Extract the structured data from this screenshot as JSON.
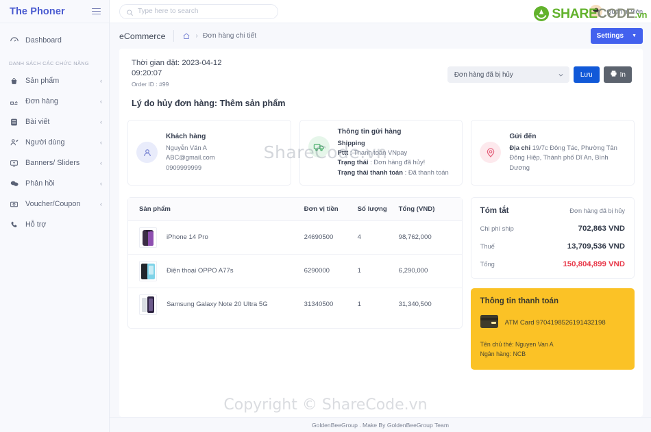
{
  "sidebar": {
    "brand": "The Phoner",
    "burger_icon": "hamburger-icon",
    "dashboard": {
      "label": "Dashboard",
      "icon": "dashboard-icon"
    },
    "section_title": "DANH SÁCH CÁC CHỨC NĂNG",
    "items": [
      {
        "label": "Sản phẩm",
        "icon": "basket-icon",
        "chevron": "‹"
      },
      {
        "label": "Đơn hàng",
        "icon": "orders-icon",
        "chevron": "‹"
      },
      {
        "label": "Bài viết",
        "icon": "article-icon",
        "chevron": "‹"
      },
      {
        "label": "Người dùng",
        "icon": "users-icon",
        "chevron": "‹"
      },
      {
        "label": "Banners/ Sliders",
        "icon": "banner-icon",
        "chevron": "‹"
      },
      {
        "label": "Phản hồi",
        "icon": "feedback-icon",
        "chevron": "‹"
      },
      {
        "label": "Voucher/Coupon",
        "icon": "voucher-icon",
        "chevron": "‹"
      },
      {
        "label": "Hỗ trợ",
        "icon": "phone-icon",
        "chevron": ""
      }
    ]
  },
  "topbar": {
    "search_placeholder": "Type here to search",
    "search_value": "",
    "search_icon": "search-icon",
    "admin_label": "Quản trị viên",
    "avatar_icon": "avatar-icon"
  },
  "breadcrumb": {
    "title": "eCommerce",
    "home_icon": "home-icon",
    "arrow": "›",
    "leaf": "Đơn hàng chi tiết",
    "settings_label": "Settings",
    "settings_caret": "▼"
  },
  "order": {
    "time_label": "Thời gian đặt: 2023-04-12",
    "time_value": "09:20:07",
    "order_id": "Order ID : #99",
    "status_selected": "Đơn hàng đã bị hủy",
    "status_options": [
      "Đơn hàng đã bị hủy"
    ],
    "save_label": "Lưu",
    "print_label": "In",
    "print_icon": "printer-icon",
    "cancel_reason": "Lý do hủy đơn hàng: Thêm sản phẩm"
  },
  "customer_card": {
    "icon": "user-icon",
    "title": "Khách hàng",
    "name": "Nguyễn Văn A",
    "email": "ABC@gmail.com",
    "phone": "0909999999"
  },
  "shipping_card": {
    "icon": "truck-icon",
    "title": "Thông tin gửi hàng",
    "shipping_label": "Shipping",
    "shipping_value": "",
    "ptt_label": "Pttt",
    "ptt_value": "Thanh toán VNpay",
    "status_label": "Trạng thái",
    "status_value": "Đơn hàng đã hủy!",
    "pay_status_label": "Trạng thái thanh toán",
    "pay_status_value": "Đã thanh toán"
  },
  "address_card": {
    "icon": "location-pin-icon",
    "title": "Gửi đến",
    "address_label": "Địa chỉ",
    "address_value": "19/7c Đông Tác, Phường Tân Đông Hiệp, Thành phố Dĩ An, Bình Dương"
  },
  "products_table": {
    "columns": [
      "Sản phẩm",
      "Đơn vị tiền",
      "Số lượng",
      "Tổng (VND)"
    ],
    "rows": [
      {
        "name": "iPhone 14 Pro",
        "unit_price": "24690500",
        "qty": "4",
        "total": "98,762,000",
        "thumb": "iphone-14-pro-thumb"
      },
      {
        "name": "Điện thoại OPPO A77s",
        "unit_price": "6290000",
        "qty": "1",
        "total": "6,290,000",
        "thumb": "oppo-a77s-thumb"
      },
      {
        "name": "Samsung Galaxy Note 20 Ultra 5G",
        "unit_price": "31340500",
        "qty": "1",
        "total": "31,340,500",
        "thumb": "galaxy-note-20-thumb"
      }
    ]
  },
  "summary": {
    "title": "Tóm tắt",
    "status": "Đơn hàng đã bị hủy",
    "rows": [
      {
        "label": "Chi phí ship",
        "value": "702,863 VND"
      },
      {
        "label": "Thuế",
        "value": "13,709,536 VND"
      }
    ],
    "total_label": "Tổng",
    "total_value": "150,804,899 VND",
    "total_color": "#e8394a"
  },
  "payment": {
    "title": "Thông tin thanh toán",
    "card_icon": "credit-card-icon",
    "card_number": "ATM Card 9704198526191432198",
    "holder": "Tên chủ thẻ: Nguyen Van A",
    "bank": "Ngân hàng: NCB",
    "bg_color": "#fbc226"
  },
  "footer": {
    "text": "GoldenBeeGroup . Make By GoldenBeeGroup Team"
  },
  "watermark": {
    "center": "ShareCode.vn",
    "footer": "Copyright © ShareCode.vn",
    "logo_share": "SHARE",
    "logo_code": "CODE",
    "logo_vn": ".vn"
  }
}
